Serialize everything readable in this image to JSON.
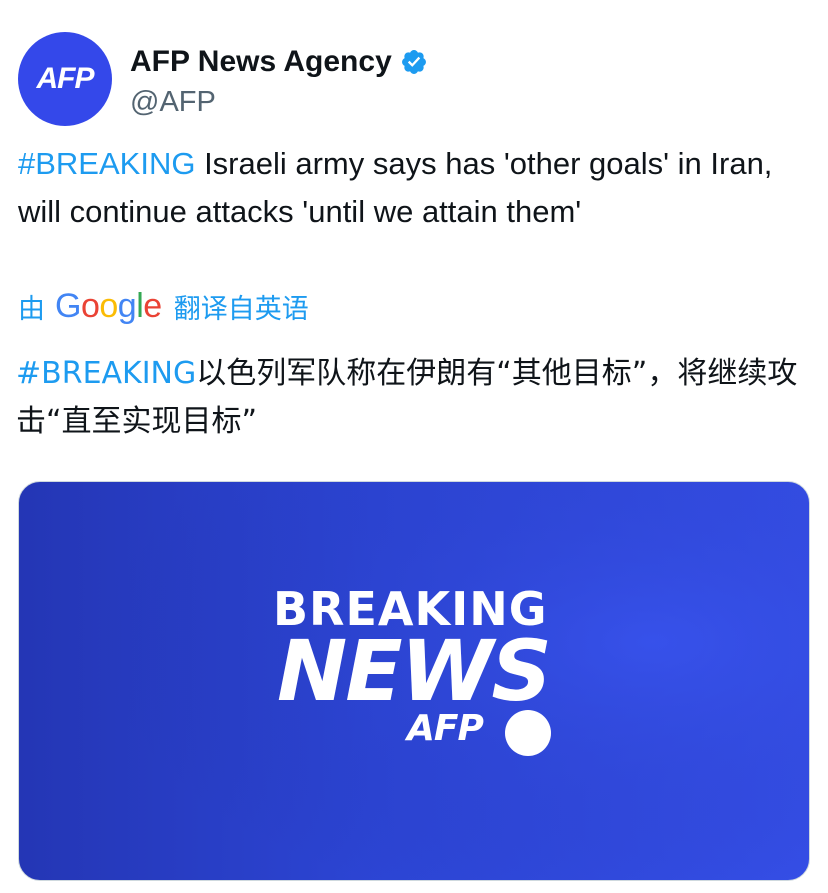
{
  "author": {
    "avatar_text": "AFP",
    "display_name": "AFP News Agency",
    "handle": "@AFP",
    "verified_icon": "verified-badge-icon",
    "avatar_color": "#3448ea"
  },
  "tweet": {
    "hashtag": "#BREAKING",
    "text": " Israeli army says has 'other goals' in Iran, will continue attacks 'until we attain them'"
  },
  "translation": {
    "by_label": "由",
    "provider": "Google",
    "suffix": "翻译自英语",
    "hashtag": "#BREAKING",
    "text": "以色列军队称在伊朗有“其他目标”，将继续攻击“直至实现目标”"
  },
  "media": {
    "line1": "BREAKING",
    "line2": "NEWS",
    "line3": "AFP",
    "background_color": "#2c45d4"
  },
  "colors": {
    "link": "#1d9bf0",
    "text": "#0f1419",
    "secondary": "#536471"
  }
}
